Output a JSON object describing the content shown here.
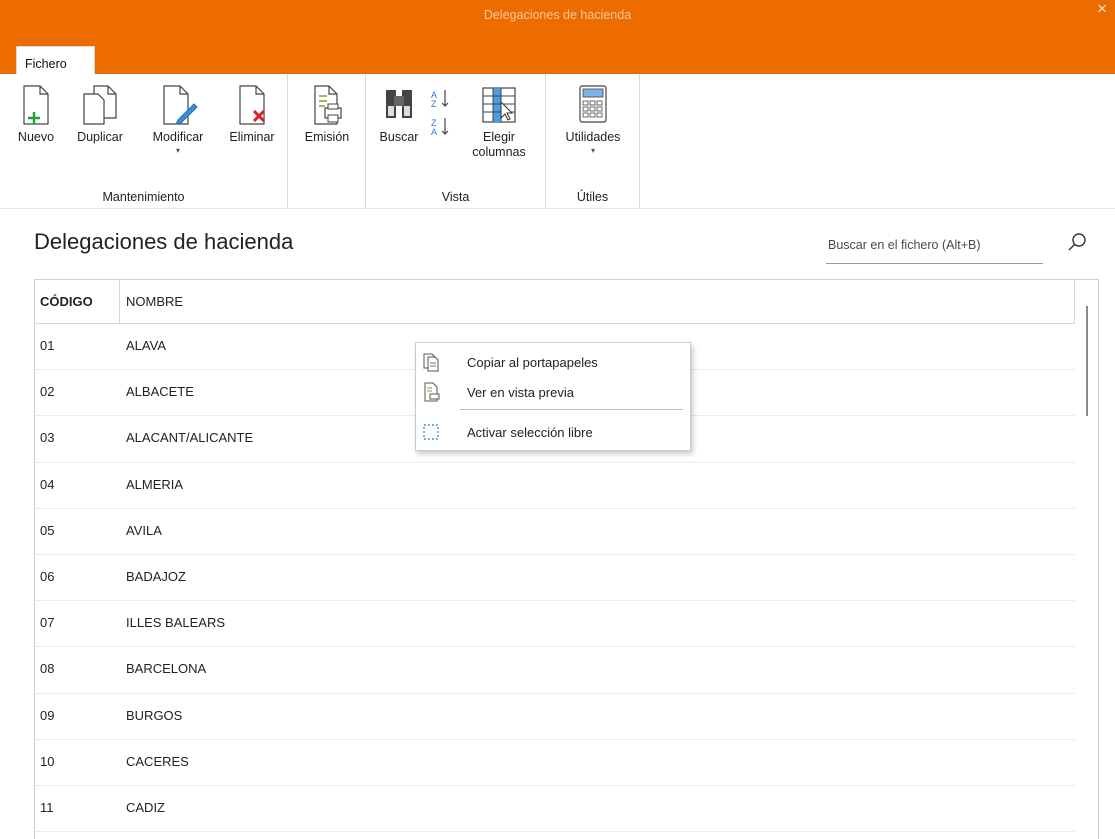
{
  "window": {
    "title": "Delegaciones de hacienda",
    "close_symbol": "×"
  },
  "tabs": [
    {
      "label": "Fichero",
      "active": true
    }
  ],
  "ribbon": {
    "groups": [
      {
        "label": "Mantenimiento",
        "buttons": [
          "Nuevo",
          "Duplicar",
          "Modificar",
          "Eliminar"
        ]
      },
      {
        "label": "",
        "buttons": [
          "Emisión"
        ]
      },
      {
        "label": "Vista",
        "buttons": [
          "Buscar",
          "Elegir columnas"
        ]
      },
      {
        "label": "Útiles",
        "buttons": [
          "Utilidades"
        ]
      }
    ],
    "nuevo": "Nuevo",
    "duplicar": "Duplicar",
    "modificar": "Modificar",
    "eliminar": "Eliminar",
    "emision": "Emisión",
    "buscar": "Buscar",
    "elegir_line1": "Elegir",
    "elegir_line2": "columnas",
    "utilidades": "Utilidades",
    "group_mantenimiento": "Mantenimiento",
    "group_vista": "Vista",
    "group_utiles": "Útiles",
    "caret": "▾"
  },
  "page": {
    "title": "Delegaciones de hacienda",
    "search_placeholder": "Buscar en el fichero (Alt+B)"
  },
  "table": {
    "columns": [
      "CÓDIGO",
      "NOMBRE"
    ],
    "rows": [
      [
        "01",
        "ALAVA"
      ],
      [
        "02",
        "ALBACETE"
      ],
      [
        "03",
        "ALACANT/ALICANTE"
      ],
      [
        "04",
        "ALMERIA"
      ],
      [
        "05",
        "AVILA"
      ],
      [
        "06",
        "BADAJOZ"
      ],
      [
        "07",
        "ILLES BALEARS"
      ],
      [
        "08",
        "BARCELONA"
      ],
      [
        "09",
        "BURGOS"
      ],
      [
        "10",
        "CACERES"
      ],
      [
        "11",
        "CADIZ"
      ],
      [
        "",
        ""
      ]
    ]
  },
  "context_menu": {
    "items": [
      {
        "label": "Copiar al portapapeles",
        "icon": "copy-icon"
      },
      {
        "label": "Ver en vista previa",
        "icon": "print-preview-icon"
      },
      {
        "label": "Activar selección libre",
        "icon": "free-selection-icon"
      }
    ]
  },
  "colors": {
    "accent": "#ec6c00",
    "ribbon_bg": "#ffffff"
  }
}
